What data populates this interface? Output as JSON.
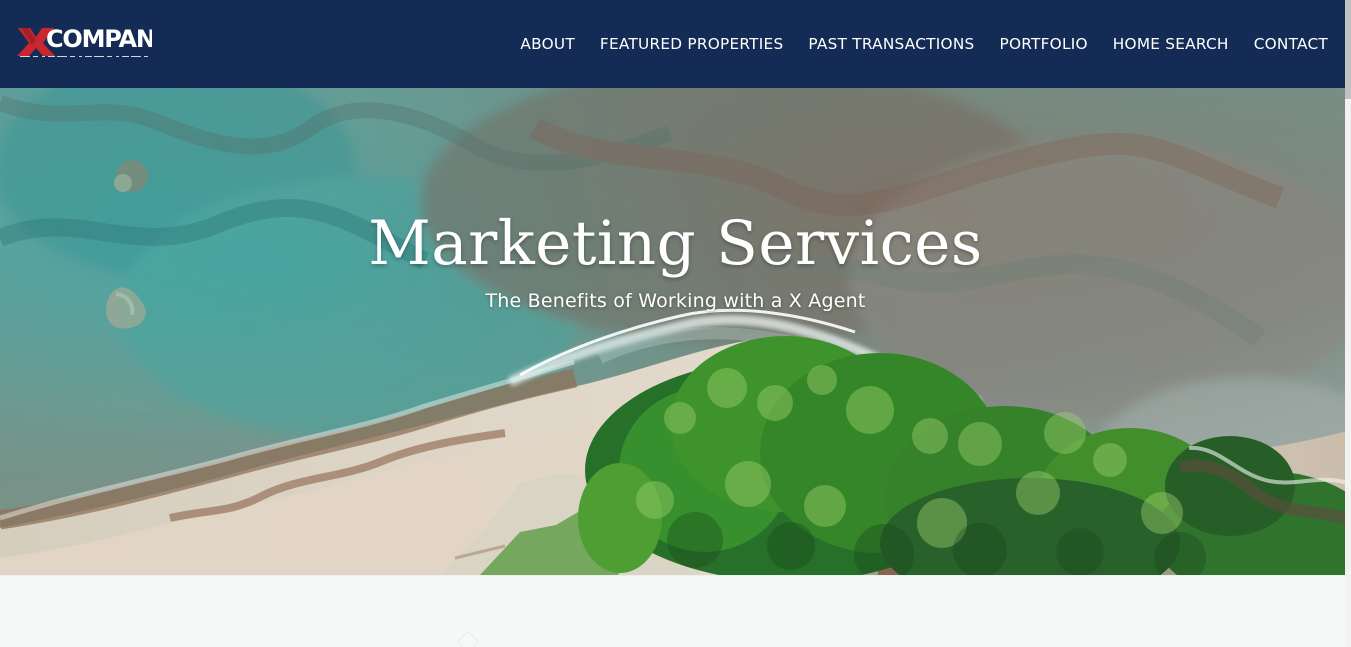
{
  "brand": {
    "logo_mark": "X",
    "logo_text": "COMPANY"
  },
  "navigation": {
    "items": [
      {
        "label": "ABOUT"
      },
      {
        "label": "FEATURED PROPERTIES"
      },
      {
        "label": "PAST TRANSACTIONS"
      },
      {
        "label": "PORTFOLIO"
      },
      {
        "label": "HOME SEARCH"
      },
      {
        "label": "CONTACT"
      }
    ]
  },
  "hero": {
    "title": "Marketing Services",
    "subtitle": "The Benefits of Working with a X Agent"
  },
  "colors": {
    "header_background": "#142c55",
    "logo_red": "#c9262d",
    "text_light": "#ffffff"
  },
  "icons": {
    "scroll": "vertical-scrollbar",
    "content_hint": "diamond-shape-icon"
  }
}
